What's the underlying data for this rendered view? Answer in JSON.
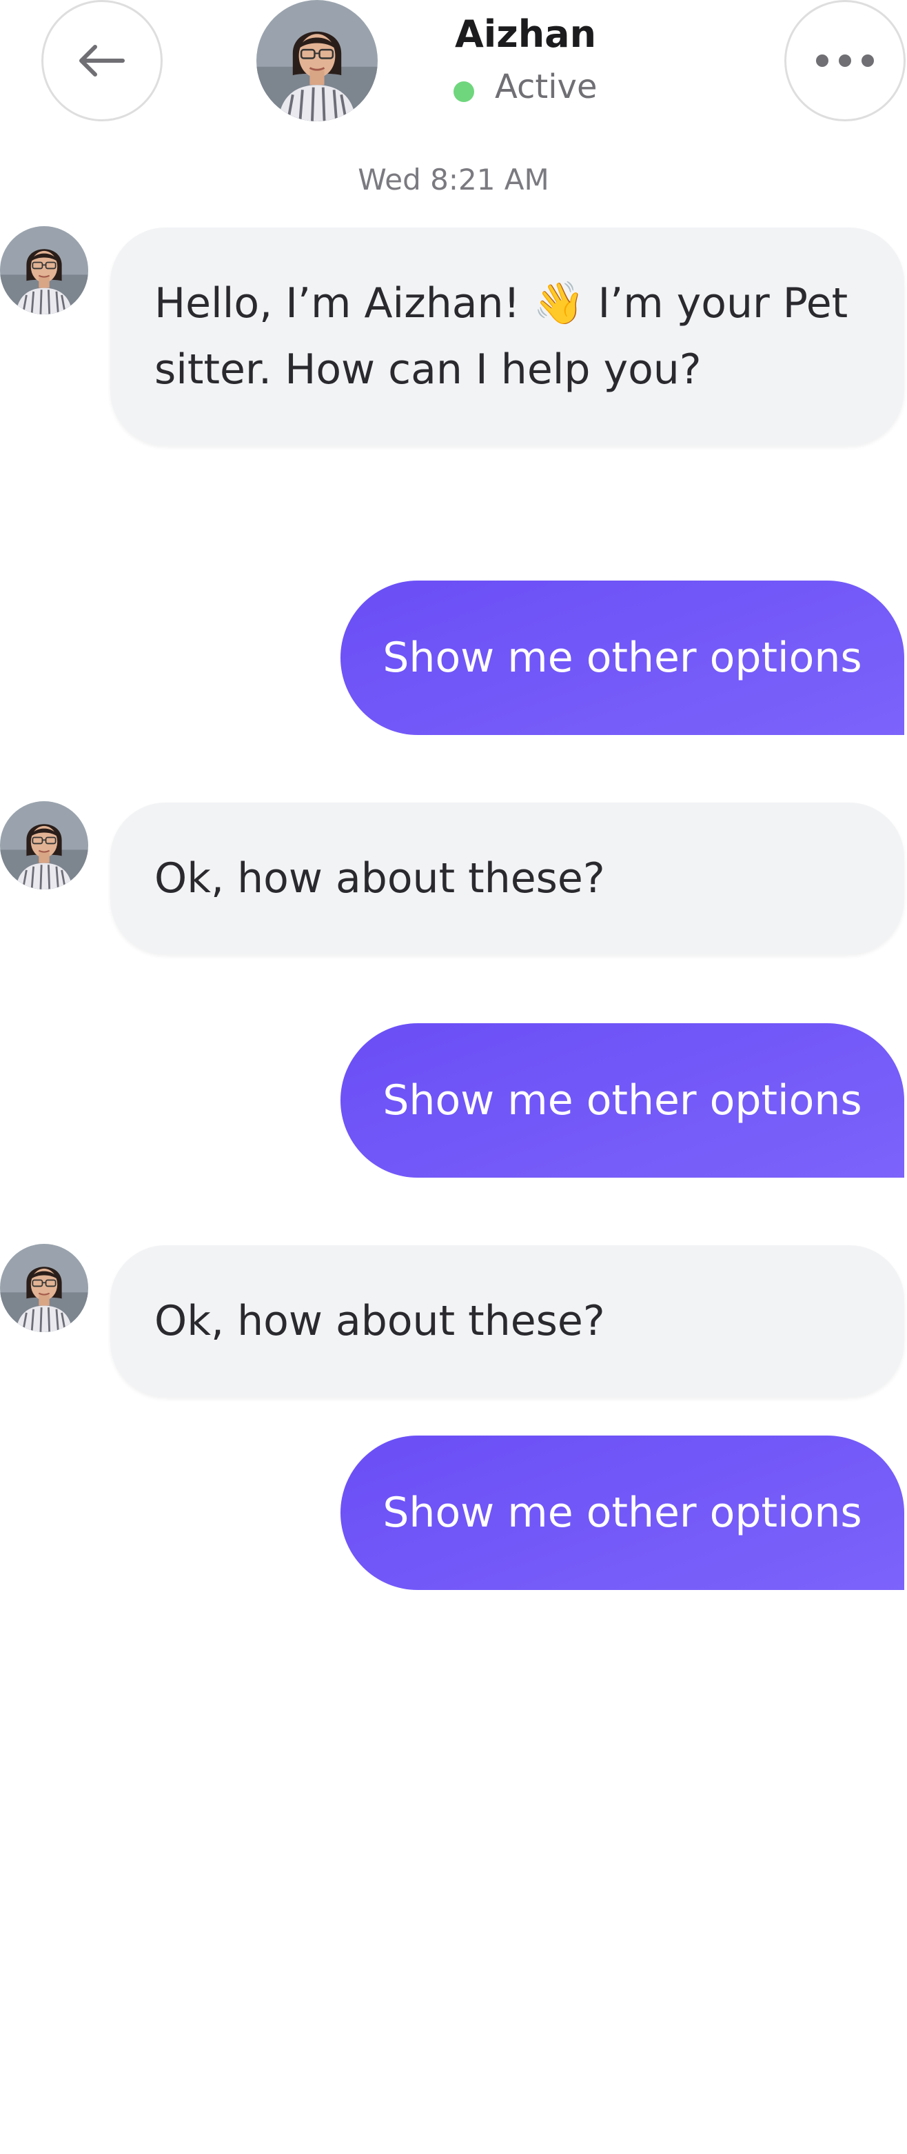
{
  "header": {
    "contact_name": "Aizhan",
    "status": "Active",
    "status_color": "#6fd67d"
  },
  "icons": {
    "back": "arrow-left-icon",
    "more": "more-horizontal-icon"
  },
  "timestamp": "Wed 8:21 AM",
  "messages": [
    {
      "from": "contact",
      "text": "Hello, I’m Aizhan! 👋 I’m your Pet sitter. How can I help you?"
    },
    {
      "from": "user",
      "text": "Show me other options"
    },
    {
      "from": "contact",
      "text": "Ok, how about these?"
    },
    {
      "from": "user",
      "text": "Show me other options"
    },
    {
      "from": "contact",
      "text": "Ok, how about these?"
    },
    {
      "from": "user",
      "text": "Show me other options"
    }
  ],
  "colors": {
    "outgoing_bubble": "#6a4ef6",
    "incoming_bubble": "#f2f3f5"
  }
}
